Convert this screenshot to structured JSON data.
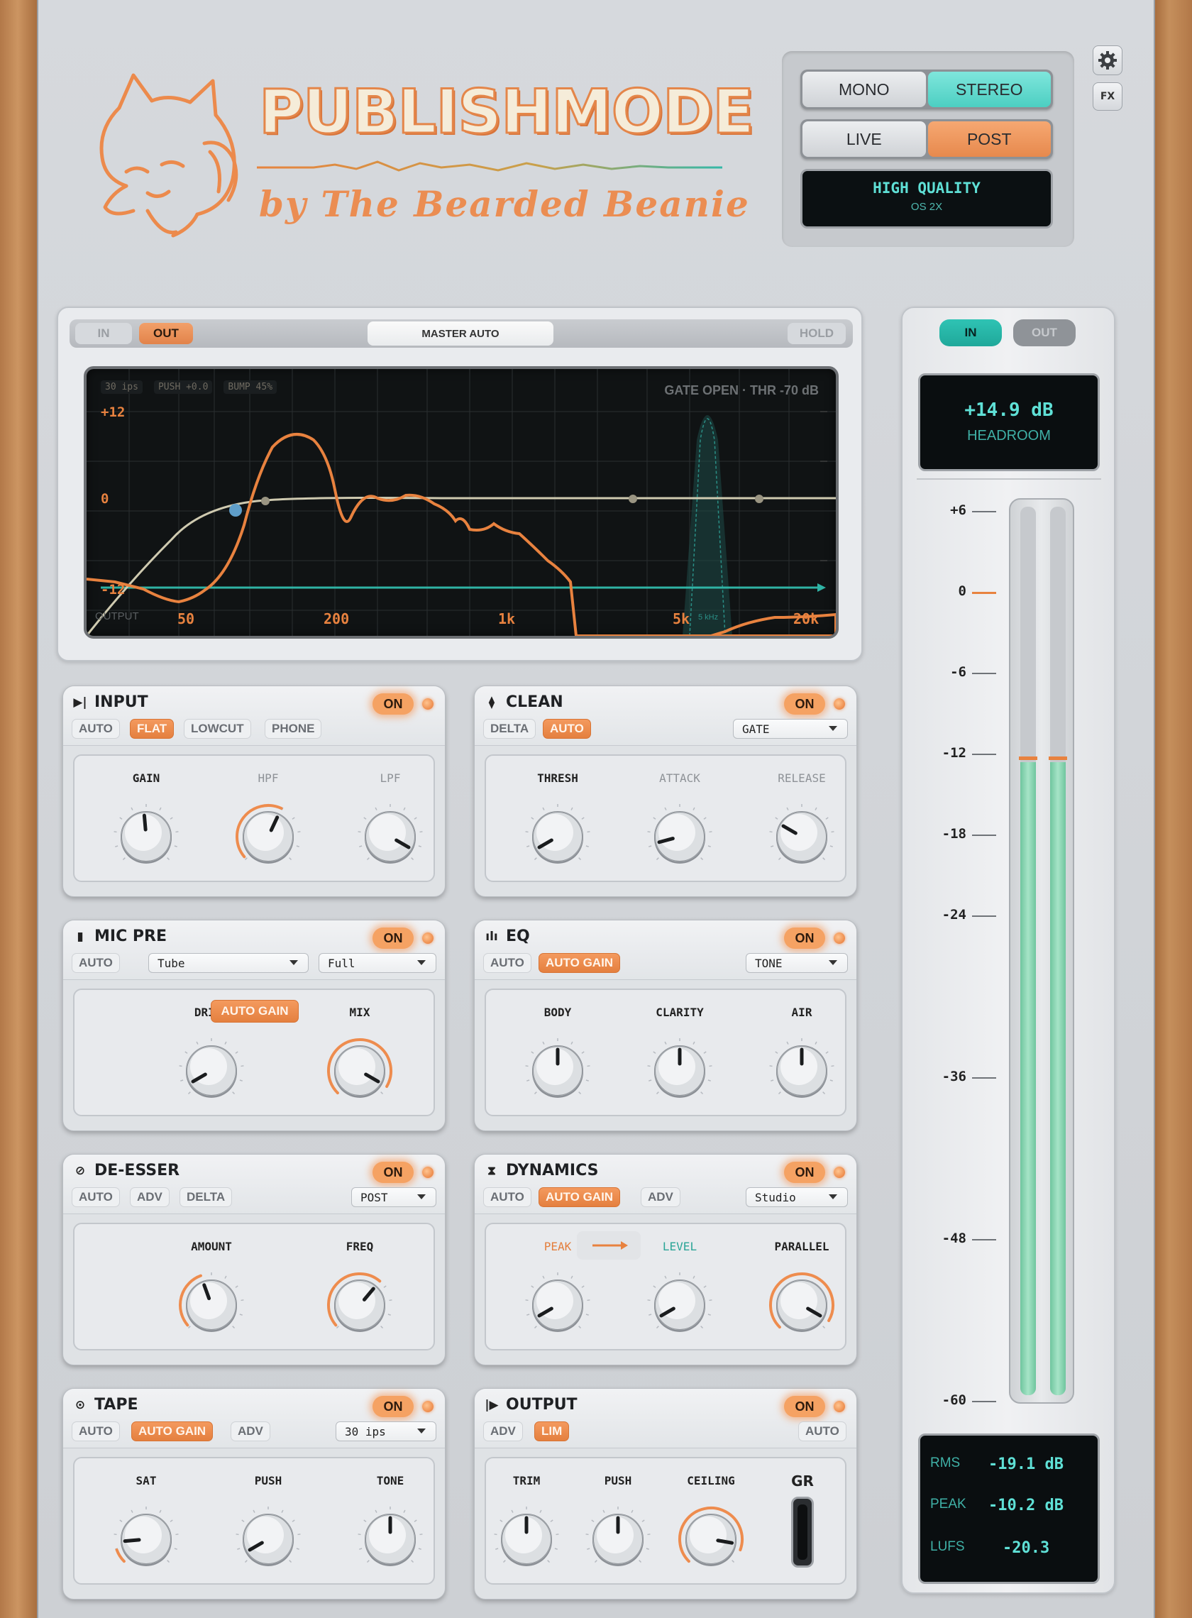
{
  "header": {
    "brand": "PUBLISHMODE",
    "byline": "by The Bearded Beanie",
    "channel": {
      "mono": "MONO",
      "stereo": "STEREO",
      "selected": "STEREO"
    },
    "mode": {
      "live": "LIVE",
      "post": "POST",
      "selected": "POST"
    },
    "quality": {
      "title": "HIGH QUALITY",
      "sub": "OS 2X"
    },
    "fx_label": "FX",
    "settings_icon": "gear-icon"
  },
  "analyzer": {
    "in_label": "IN",
    "out_label": "OUT",
    "master_label": "MASTER AUTO",
    "hold_label": "HOLD",
    "info": [
      "30 ips",
      "PUSH +0.0",
      "BUMP 45%"
    ],
    "gate_text": "GATE OPEN · THR -70 dB",
    "db_labels": [
      "+12",
      "0",
      "-12"
    ],
    "freq_labels": [
      "50",
      "200",
      "1k",
      "5k",
      "20k"
    ],
    "output_label": "OUTPUT",
    "band_label": "5 kHz",
    "colors": {
      "curve": "#e8823f",
      "eq_line": "#cfcab0",
      "threshold": "#2fb3a5"
    }
  },
  "modules": {
    "input": {
      "title": "INPUT",
      "on": "ON",
      "chips": [
        "AUTO",
        "FLAT",
        "LOWCUT",
        "PHONE"
      ],
      "active": "FLAT",
      "knobs": [
        "GAIN",
        "HPF",
        "LPF"
      ]
    },
    "clean": {
      "title": "CLEAN",
      "on": "ON",
      "chips": [
        "DELTA",
        "AUTO"
      ],
      "active": "AUTO",
      "dropdown": "GATE",
      "knobs": [
        "THRESH",
        "ATTACK",
        "RELEASE"
      ]
    },
    "micpre": {
      "title": "MIC PRE",
      "on": "ON",
      "chips": [
        "AUTO"
      ],
      "dropdown1": "Tube",
      "dropdown2": "Full",
      "center_chip": "AUTO GAIN",
      "knobs": [
        "DRIVE",
        "MIX"
      ]
    },
    "eq": {
      "title": "EQ",
      "on": "ON",
      "chips": [
        "AUTO",
        "AUTO GAIN"
      ],
      "active": "AUTO GAIN",
      "dropdown": "TONE",
      "knobs": [
        "BODY",
        "CLARITY",
        "AIR"
      ]
    },
    "deesser": {
      "title": "DE-ESSER",
      "on": "ON",
      "chips": [
        "AUTO",
        "ADV",
        "DELTA"
      ],
      "dropdown": "POST",
      "knobs": [
        "AMOUNT",
        "FREQ"
      ]
    },
    "dynamics": {
      "title": "DYNAMICS",
      "on": "ON",
      "chips": [
        "AUTO",
        "AUTO GAIN",
        "ADV"
      ],
      "active": "AUTO GAIN",
      "dropdown": "Studio",
      "knobs": [
        "PEAK",
        "LEVEL",
        "PARALLEL"
      ]
    },
    "tape": {
      "title": "TAPE",
      "on": "ON",
      "chips": [
        "AUTO",
        "AUTO GAIN",
        "ADV"
      ],
      "active": "AUTO GAIN",
      "dropdown": "30 ips",
      "knobs": [
        "SAT",
        "PUSH",
        "TONE"
      ]
    },
    "output": {
      "title": "OUTPUT",
      "on": "ON",
      "chips": [
        "ADV",
        "LIM"
      ],
      "active": "LIM",
      "auto_chip": "AUTO",
      "knobs": [
        "TRIM",
        "PUSH",
        "CEILING"
      ],
      "gr_label": "GR"
    }
  },
  "meter": {
    "in_label": "IN",
    "out_label": "OUT",
    "headroom_value": "+14.9 dB",
    "headroom_label": "HEADROOM",
    "scale": [
      "+6",
      "0",
      "-6",
      "-12",
      "-18",
      "-24",
      "-36",
      "-48",
      "-60"
    ],
    "readouts": [
      {
        "label": "RMS",
        "value": "-19.1 dB"
      },
      {
        "label": "PEAK",
        "value": "-10.2 dB"
      },
      {
        "label": "LUFS",
        "value": "-20.3"
      }
    ],
    "level_db": -12.5,
    "colors": {
      "fill": "#8fd7b5",
      "accent": "#e8823f"
    }
  }
}
